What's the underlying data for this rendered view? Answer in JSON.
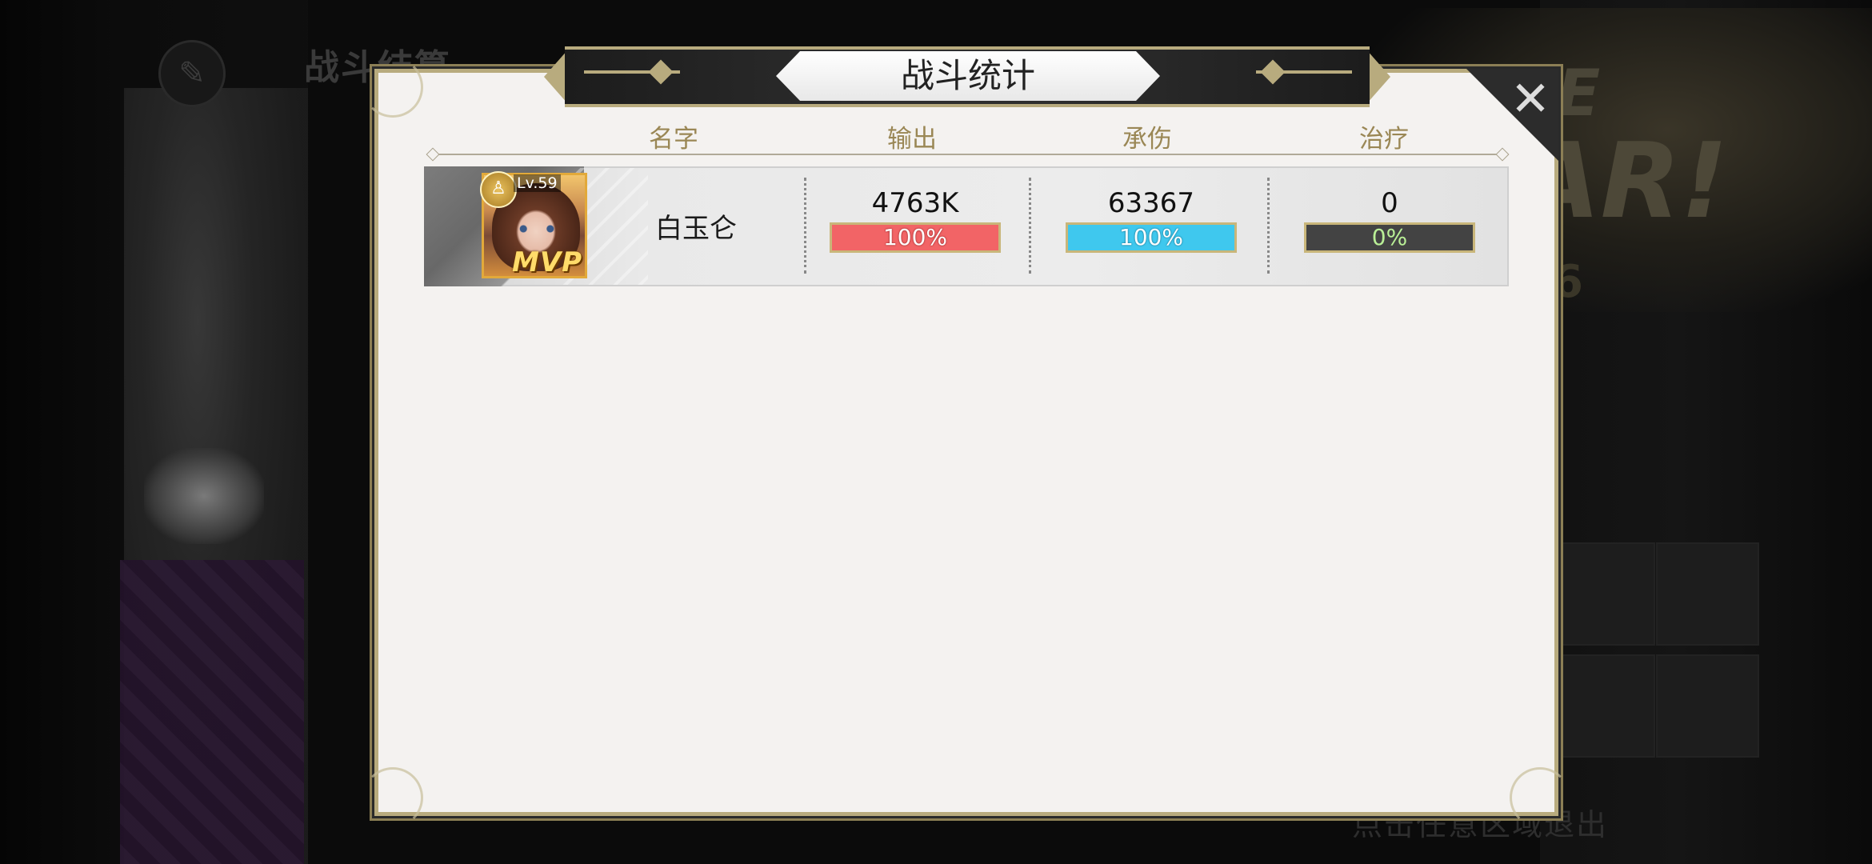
{
  "background": {
    "screen_title": "战斗结算",
    "exit_hint": "点击任意区域退出",
    "logo_line1": "GE",
    "logo_line2": "AR!",
    "logo_number": "6"
  },
  "dialog": {
    "title": "战斗统计",
    "close_symbol": "✕",
    "columns": [
      "名字",
      "输出",
      "承伤",
      "治疗"
    ],
    "rows": [
      {
        "level": "Lv.59",
        "badge": "MVP",
        "name": "白玉仑",
        "damage": "4763K",
        "damage_pct": "100%",
        "taken": "63367",
        "taken_pct": "100%",
        "heal": "0",
        "heal_pct": "0%"
      }
    ]
  },
  "colors": {
    "damage_bar": "#f26466",
    "taken_bar": "#3fc8ee",
    "heal_bar": "#434343",
    "gold_accent": "#b8ab7e"
  }
}
